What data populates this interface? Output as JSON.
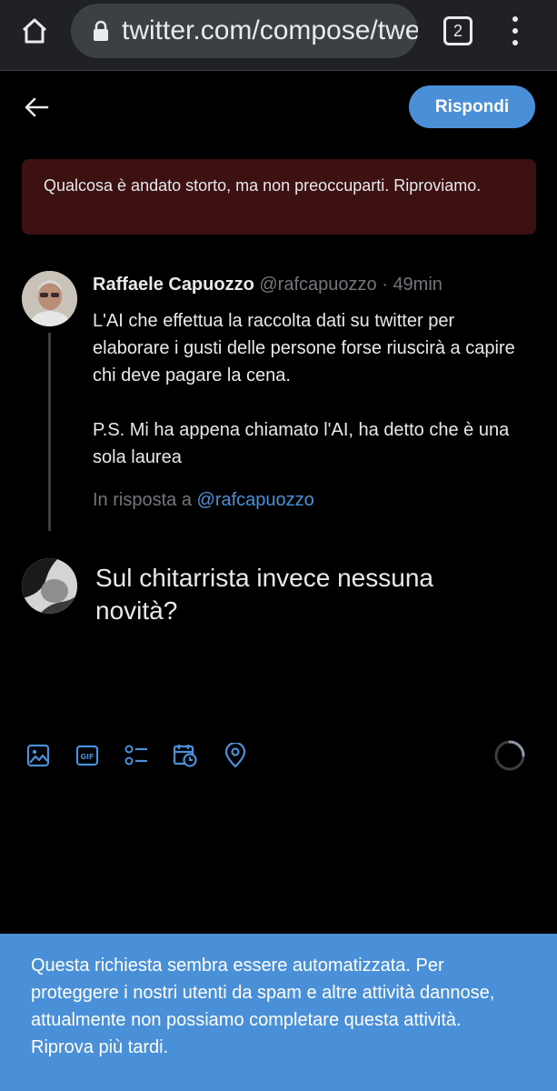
{
  "browser": {
    "url": "twitter.com/compose/twe",
    "tab_count": "2"
  },
  "header": {
    "reply_label": "Rispondi"
  },
  "error": {
    "message": "Qualcosa è andato storto, ma non preoccuparti. Riproviamo."
  },
  "tweet": {
    "author_name": "Raffaele Capuozzo",
    "author_handle": "@rafcapuozzo",
    "separator": "·",
    "time": "49min",
    "paragraphs": [
      "L'AI che effettua la raccolta dati su twitter per elaborare i gusti delle persone forse riuscirà a capire chi deve pagare la cena.",
      "P.S. Mi ha appena chiamato l'AI, ha detto che è una sola laurea"
    ],
    "reply_to_prefix": "In risposta a",
    "reply_to_handle": "@rafcapuozzo"
  },
  "composer": {
    "text": "Sul chitarrista invece nessuna novità?"
  },
  "toolbar": {
    "icons": [
      "image-icon",
      "gif-icon",
      "poll-icon",
      "schedule-icon",
      "location-icon"
    ]
  },
  "notice": {
    "message": "Questa richiesta sembra essere automatizzata. Per proteggere i nostri utenti da spam e altre attività dannose, attualmente non possiamo completare questa attività. Riprova più tardi."
  },
  "colors": {
    "accent": "#4a90d9",
    "error_bg": "#3d1012",
    "background": "#000000",
    "muted_text": "#71767b"
  }
}
